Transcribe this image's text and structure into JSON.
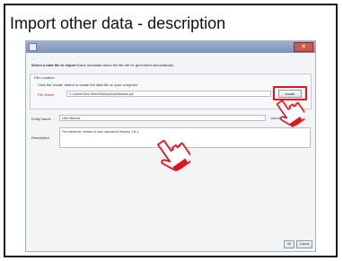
{
  "slide": {
    "title": "Import other data - description"
  },
  "window": {
    "close_symbol": "✕"
  },
  "dialog": {
    "heading_bold": "Select a data file to import",
    "heading_rest": " Basic metadata about the file will be generated automatically",
    "group_title": "File Location",
    "group_hint": "Click the 'locate' button to locate the data file on your computer",
    "file_label": "File Name",
    "file_path": "C:\\Users\\Chen Shen\\Desktop\\UserManual.pdf",
    "locate_button": "locate",
    "entity_label": "Entity Name",
    "entity_value": "User Manual",
    "entity_note": "Just used if left blank",
    "description_label": "Description",
    "description_value": "The electronic version of user manual for Morpho 1.8.1",
    "ok_button": "OK",
    "cancel_button": "Cancel"
  },
  "colors": {
    "highlight": "#e0141e",
    "pointer": "#e0141e"
  },
  "icons": {
    "pointer": "hand-pointer-icon"
  }
}
